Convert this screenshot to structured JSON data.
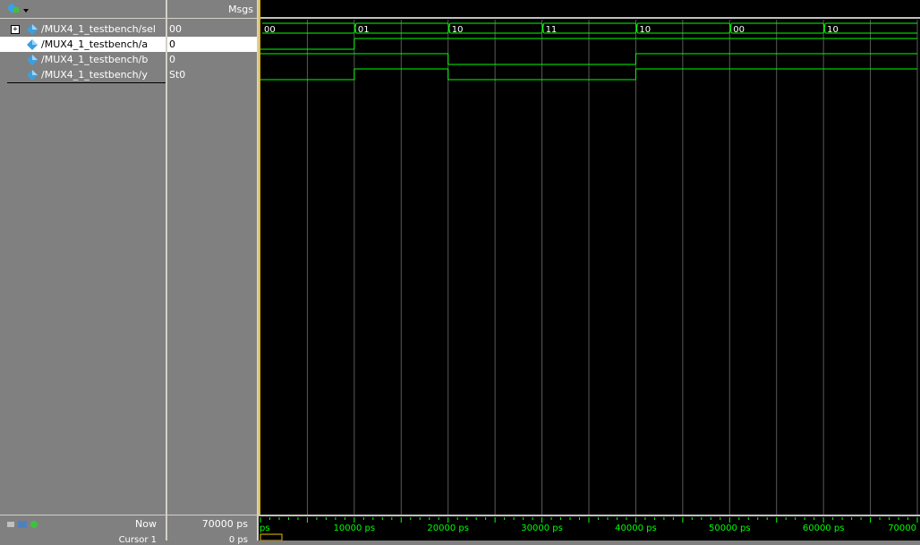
{
  "header": {
    "msgs_label": "Msgs"
  },
  "signals": [
    {
      "name": "/MUX4_1_testbench/sel",
      "value": "00",
      "expandable": true
    },
    {
      "name": "/MUX4_1_testbench/a",
      "value": "0",
      "expandable": false,
      "selected": true
    },
    {
      "name": "/MUX4_1_testbench/b",
      "value": "0",
      "expandable": false
    },
    {
      "name": "/MUX4_1_testbench/y",
      "value": "St0",
      "expandable": false
    }
  ],
  "bus_values": [
    "00",
    "01",
    "10",
    "11",
    "10",
    "00",
    "10"
  ],
  "footer": {
    "now_label": "Now",
    "now_value": "70000 ps",
    "cursor_label": "Cursor 1",
    "cursor_value": "0 ps"
  },
  "timeline": {
    "start_label": "ps",
    "tick_labels": [
      "10000 ps",
      "20000 ps",
      "30000 ps",
      "40000 ps",
      "50000 ps",
      "60000 ps",
      "70000"
    ]
  },
  "colors": {
    "wave": "#00ff00",
    "background": "#000000",
    "grid": "#5a5a5a",
    "cursor": "#f0c000",
    "diamond": "#3aa0e0"
  },
  "waves": {
    "time_end_ps": 70000,
    "segment_ps": 10000,
    "a": [
      0,
      1,
      1,
      1,
      1,
      1,
      1
    ],
    "b": [
      1,
      1,
      0,
      0,
      1,
      1,
      1
    ],
    "y": [
      0,
      1,
      0,
      0,
      1,
      1,
      1
    ]
  }
}
